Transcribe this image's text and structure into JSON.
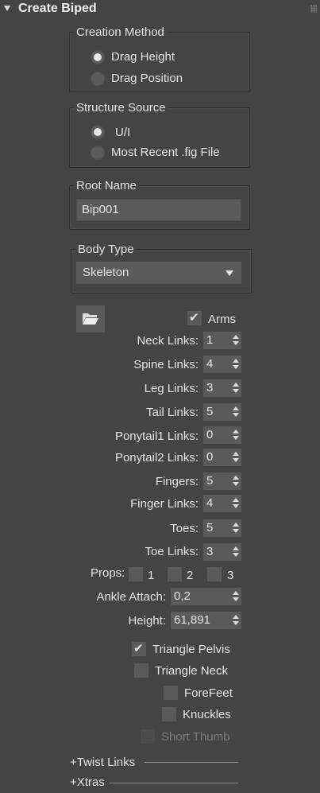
{
  "rollout": {
    "title": "Create Biped"
  },
  "creation_method": {
    "title": "Creation Method",
    "options": [
      {
        "label": "Drag Height",
        "selected": true
      },
      {
        "label": "Drag Position",
        "selected": false
      }
    ]
  },
  "structure_source": {
    "title": "Structure Source",
    "options": [
      {
        "label": "U/I",
        "selected": true
      },
      {
        "label": "Most Recent .fig File",
        "selected": false
      }
    ]
  },
  "root_name": {
    "title": "Root Name",
    "value": "Bip001"
  },
  "body_type": {
    "title": "Body Type",
    "value": "Skeleton"
  },
  "arms": {
    "label": "Arms",
    "checked": true
  },
  "spinners": [
    {
      "label": "Neck Links:",
      "value": "1"
    },
    {
      "label": "Spine Links:",
      "value": "4"
    },
    {
      "label": "Leg Links:",
      "value": "3"
    },
    {
      "label": "Tail Links:",
      "value": "5"
    },
    {
      "label": "Ponytail1 Links:",
      "value": "0"
    },
    {
      "label": "Ponytail2 Links:",
      "value": "0"
    },
    {
      "label": "Fingers:",
      "value": "5"
    },
    {
      "label": "Finger Links:",
      "value": "4"
    },
    {
      "label": "Toes:",
      "value": "5"
    },
    {
      "label": "Toe Links:",
      "value": "3"
    }
  ],
  "props": {
    "label": "Props:",
    "items": [
      "1",
      "2",
      "3"
    ]
  },
  "ankle_attach": {
    "label": "Ankle Attach:",
    "value": "0,2"
  },
  "height": {
    "label": "Height:",
    "value": "61,891"
  },
  "options": [
    {
      "label": "Triangle Pelvis",
      "checked": true
    },
    {
      "label": "Triangle Neck",
      "checked": false
    },
    {
      "label": "ForeFeet",
      "checked": false
    },
    {
      "label": "Knuckles",
      "checked": false
    },
    {
      "label": "Short Thumb",
      "checked": false,
      "disabled": true
    }
  ],
  "sections": {
    "twist_links": "+Twist Links",
    "xtras": "+Xtras"
  },
  "icons": {
    "rollout_toggle": "triangle-down-icon",
    "load_fig": "folder-open-icon"
  }
}
